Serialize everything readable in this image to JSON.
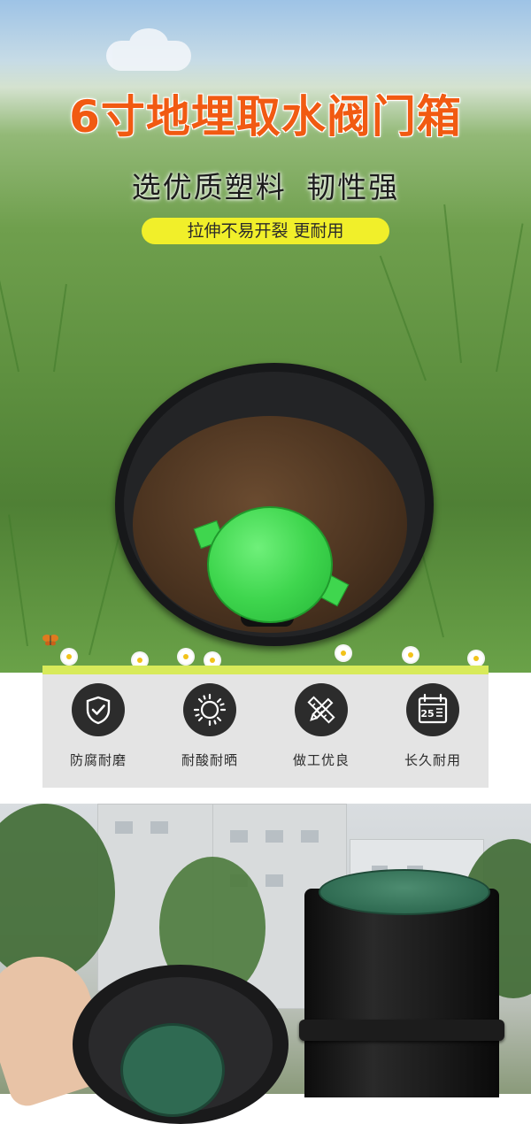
{
  "hero": {
    "title": "6寸地埋取水阀门箱",
    "subtitle": "选优质塑料 韧性强",
    "pill": "拉伸不易开裂 更耐用",
    "colors": {
      "title": "#f15a12",
      "pill_bg": "#f1ef2a"
    }
  },
  "features": [
    {
      "icon": "shield-check-icon",
      "label": "防腐耐磨"
    },
    {
      "icon": "sun-icon",
      "label": "耐酸耐晒"
    },
    {
      "icon": "pencil-ruler-icon",
      "label": "做工优良"
    },
    {
      "icon": "calendar-25-icon",
      "label": "长久耐用"
    }
  ],
  "calendar_icon_text": "25"
}
